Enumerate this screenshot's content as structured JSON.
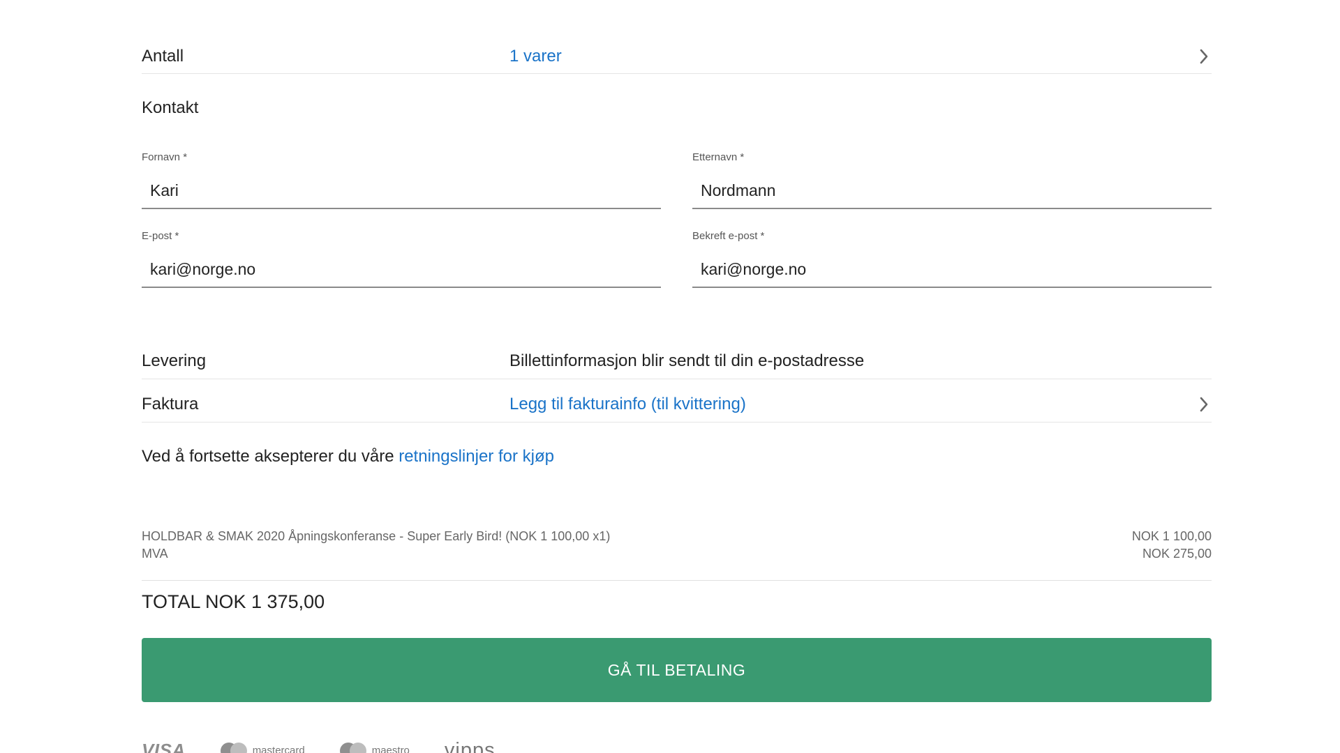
{
  "quantity_row": {
    "label": "Antall",
    "value": "1 varer"
  },
  "contact": {
    "title": "Kontakt",
    "first_name": {
      "label": "Fornavn *",
      "value": "Kari"
    },
    "last_name": {
      "label": "Etternavn *",
      "value": "Nordmann"
    },
    "email": {
      "label": "E-post *",
      "value": "kari@norge.no"
    },
    "confirm_email": {
      "label": "Bekreft e-post *",
      "value": "kari@norge.no"
    }
  },
  "delivery_row": {
    "label": "Levering",
    "value": "Billettinformasjon blir sendt til din e-postadresse"
  },
  "invoice_row": {
    "label": "Faktura",
    "value": "Legg til fakturainfo (til kvittering)"
  },
  "terms": {
    "prefix": "Ved å fortsette aksepterer du våre",
    "link": "retningslinjer for kjøp"
  },
  "summary": {
    "items": [
      {
        "description": "HOLDBAR & SMAK 2020 Åpningskonferanse - Super Early Bird! (NOK 1 100,00 x1)",
        "amount": "NOK 1 100,00"
      },
      {
        "description": "MVA",
        "amount": "NOK 275,00"
      }
    ],
    "total": "TOTAL NOK 1 375,00"
  },
  "pay_button": "GÅ TIL BETALING",
  "payment_logos": {
    "visa": "VISA",
    "mastercard": "mastercard",
    "maestro": "maestro",
    "vipps": "vipps"
  },
  "colors": {
    "link": "#1a73c8",
    "button": "#3a9a71"
  }
}
